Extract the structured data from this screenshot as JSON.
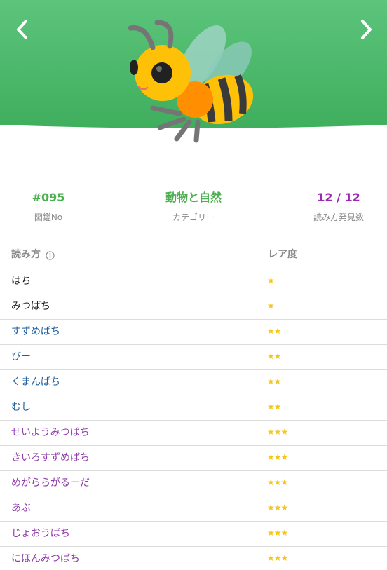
{
  "nav": {
    "prev_icon": "chevron-left-icon",
    "next_icon": "chevron-right-icon"
  },
  "header": {
    "color": "#4cbb6a",
    "image": "bee-icon"
  },
  "stats": [
    {
      "value": "#095",
      "label": "図鑑No",
      "color": "#4caf50"
    },
    {
      "value": "動物と自然",
      "label": "カテゴリー",
      "color": "#4caf50"
    },
    {
      "value": "12 / 12",
      "label": "読み方発見数",
      "color": "#9c27b0"
    }
  ],
  "table": {
    "headers": {
      "yomi": "読み方",
      "rarity": "レア度"
    },
    "rows": [
      {
        "name": "はち",
        "stars": "★",
        "color": "#222222"
      },
      {
        "name": "みつばち",
        "stars": "★",
        "color": "#222222"
      },
      {
        "name": "すずめばち",
        "stars": "★★",
        "color": "#1e5fa0"
      },
      {
        "name": "びー",
        "stars": "★★",
        "color": "#1e5fa0"
      },
      {
        "name": "くまんばち",
        "stars": "★★",
        "color": "#1e5fa0"
      },
      {
        "name": "むし",
        "stars": "★★",
        "color": "#1e5fa0"
      },
      {
        "name": "せいようみつばち",
        "stars": "★★★",
        "color": "#8e3aa8"
      },
      {
        "name": "きいろすずめばち",
        "stars": "★★★",
        "color": "#8e3aa8"
      },
      {
        "name": "めがららがるーだ",
        "stars": "★★★",
        "color": "#8e3aa8"
      },
      {
        "name": "あぶ",
        "stars": "★★★",
        "color": "#8e3aa8"
      },
      {
        "name": "じょおうばち",
        "stars": "★★★",
        "color": "#8e3aa8"
      },
      {
        "name": "にほんみつばち",
        "stars": "★★★",
        "color": "#8e3aa8"
      }
    ]
  }
}
